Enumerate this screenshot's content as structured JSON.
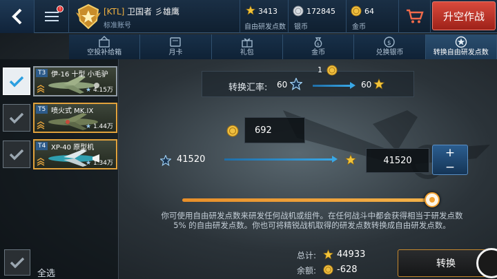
{
  "header": {
    "clan_tag": "[KTL]",
    "player_name": "卫国者 彡雄鹰",
    "account_type": "标准账号",
    "notification_badge": "!",
    "free_xp": {
      "value": "3413",
      "label": "自由研发点数"
    },
    "silver": {
      "value": "172845",
      "label": "银币"
    },
    "gold": {
      "value": "64",
      "label": "金币"
    },
    "takeoff_label": "升空作战"
  },
  "tabs": [
    {
      "label": "空投补给箱",
      "icon": "crate-icon",
      "active": false
    },
    {
      "label": "月卡",
      "icon": "card-icon",
      "active": false
    },
    {
      "label": "礼包",
      "icon": "gift-icon",
      "active": false
    },
    {
      "label": "金币",
      "icon": "money-bag-icon",
      "active": false
    },
    {
      "label": "兑换银币",
      "icon": "silver-exchange-icon",
      "active": false
    },
    {
      "label": "转换自由研发点数",
      "icon": "star-exchange-icon",
      "active": true
    }
  ],
  "aircraft": [
    {
      "tier": "T3",
      "name": "伊-16 十型 小毛驴",
      "points": "4.15万",
      "checked": true
    },
    {
      "tier": "T5",
      "name": "喷火式 MK.IX",
      "points": "1.44万",
      "checked": false
    },
    {
      "tier": "T4",
      "name": "XP-40 原型机",
      "points": "1.34万",
      "checked": false
    }
  ],
  "select_all_label": "全选",
  "rate": {
    "label": "转换汇率:",
    "gold_cost": "1",
    "from_value": "60",
    "to_value": "60"
  },
  "conversion": {
    "gold_amount": "692",
    "source_points": "41520",
    "target_points": "41520",
    "plus": "+",
    "minus": "−",
    "slider_fraction": 1.0
  },
  "description": "你可使用自由研发点数来研发任何战机或组件。在任何战斗中都会获得相当于研发点数 5% 的自由研发点数。你也可将精锐战机取得的研发点数转换成自由研发点数。",
  "totals": {
    "total_label": "总计:",
    "total_value": "44933",
    "balance_label": "余额:",
    "balance_value": "-628"
  },
  "convert_button_label": "转换",
  "colors": {
    "accent_orange": "#f0a030",
    "takeoff_red": "#c2352a",
    "bar_blue": "#1a2f45"
  }
}
